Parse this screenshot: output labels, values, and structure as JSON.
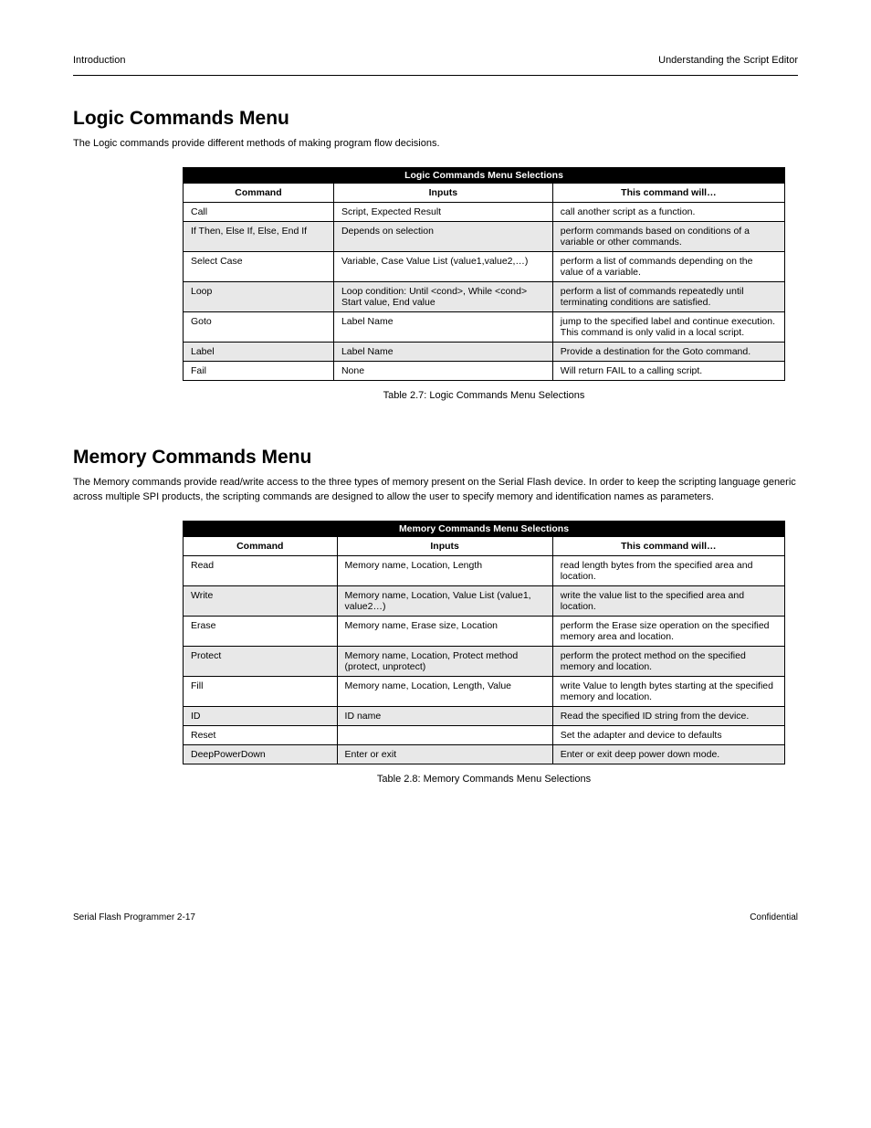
{
  "header": {
    "left": "Introduction",
    "right": "Understanding the Script Editor"
  },
  "section1": {
    "title": "Logic Commands Menu",
    "desc": "The Logic commands provide different methods of making program flow decisions.",
    "tableHeader": {
      "c1": "Command",
      "c2": "Inputs",
      "c3": "This command will…"
    },
    "rows": [
      {
        "c1": "Call",
        "c2": "Script, Expected Result",
        "c3": "call another script as a function."
      },
      {
        "c1": "If Then, Else If, Else, End If",
        "c2": "Depends on selection",
        "c3": "perform commands based on conditions of a variable or other commands."
      },
      {
        "c1": "Select Case",
        "c2": "Variable, Case Value List\n(value1,value2,…)",
        "c3": "perform a list of commands depending on the value of a variable."
      },
      {
        "c1": "Loop",
        "c2": "Loop condition:\nUntil <cond>, While <cond>\nStart value, End value",
        "c3": "perform a list of commands repeatedly until terminating conditions are satisfied."
      },
      {
        "c1": "Goto",
        "c2": "Label Name",
        "c3": "jump to the specified label and continue execution. This command is only valid in a local script."
      },
      {
        "c1": "Label",
        "c2": "Label Name",
        "c3": "Provide a destination for the Goto command."
      },
      {
        "c1": "Fail",
        "c2": "None",
        "c3": "Will return FAIL to a calling script."
      }
    ],
    "caption": "Table 2.7: Logic Commands Menu Selections"
  },
  "section2": {
    "title": "Memory Commands Menu",
    "desc": "The Memory commands provide read/write access to the three types of memory present on the Serial Flash device. In order to keep the scripting language generic across multiple SPI products, the scripting commands are designed to allow the user to specify memory and identification names as parameters.",
    "tableHeader": {
      "c1": "Command",
      "c2": "Inputs",
      "c3": "This command will…"
    },
    "rows": [
      {
        "c1": "Read",
        "c2": "Memory name, Location,\nLength",
        "c3": "read length bytes from the specified area and location."
      },
      {
        "c1": "Write",
        "c2": "Memory name, Location,\nValue List (value1, value2…)",
        "c3": "write the value list to the specified area and location."
      },
      {
        "c1": "Erase",
        "c2": "Memory name, Erase size,\nLocation",
        "c3": "perform the Erase size operation on the specified memory area and location."
      },
      {
        "c1": "Protect",
        "c2": "Memory name, Location,\nProtect method (protect,\nunprotect)",
        "c3": "perform the protect method on the specified memory and location."
      },
      {
        "c1": "Fill",
        "c2": "Memory name, Location,\nLength, Value",
        "c3": "write Value to length bytes starting at the specified memory and location."
      },
      {
        "c1": "ID",
        "c2": "ID name",
        "c3": "Read the specified ID string from the device."
      },
      {
        "c1": "Reset",
        "c2": "",
        "c3": "Set the adapter and device to defaults"
      },
      {
        "c1": "DeepPowerDown",
        "c2": "Enter or exit",
        "c3": "Enter or exit deep power down mode."
      }
    ],
    "caption": "Table 2.8: Memory Commands Menu Selections"
  },
  "footer": {
    "left": "Serial Flash Programmer 2-17",
    "right": "Confidential"
  }
}
